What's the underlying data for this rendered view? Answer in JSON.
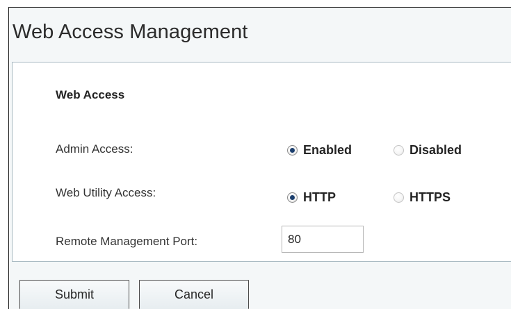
{
  "header": {
    "title": "Web Access Management"
  },
  "section": {
    "title": "Web Access"
  },
  "fields": {
    "admin_access": {
      "label": "Admin Access:",
      "options": [
        {
          "label": "Enabled",
          "selected": true
        },
        {
          "label": "Disabled",
          "selected": false
        }
      ]
    },
    "web_utility_access": {
      "label": "Web Utility Access:",
      "options": [
        {
          "label": "HTTP",
          "selected": true
        },
        {
          "label": "HTTPS",
          "selected": false
        }
      ]
    },
    "remote_management_port": {
      "label": "Remote Management Port:",
      "value": "80"
    }
  },
  "actions": {
    "submit_label": "Submit",
    "cancel_label": "Cancel"
  }
}
